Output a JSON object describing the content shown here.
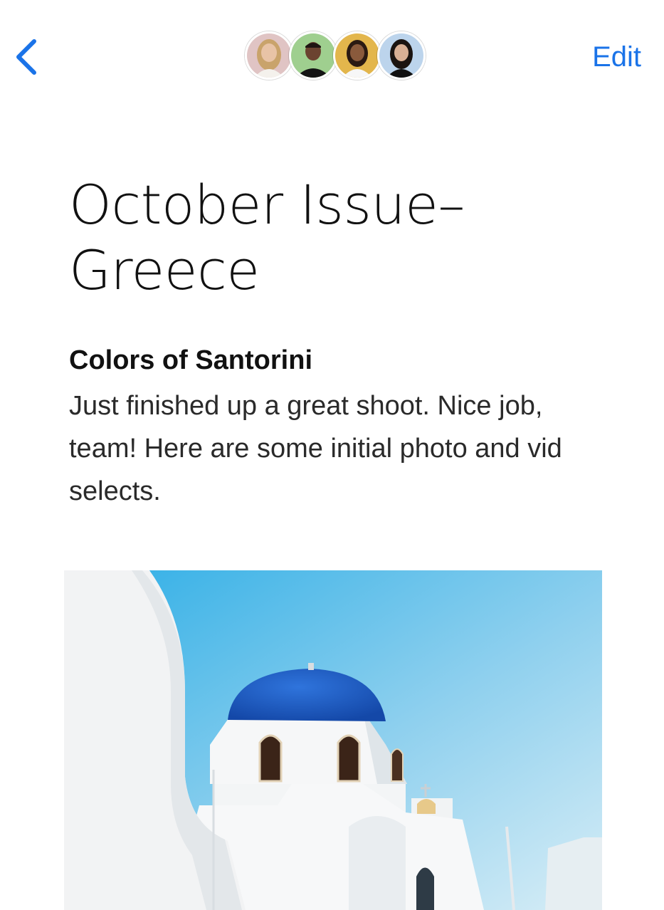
{
  "nav": {
    "edit_label": "Edit"
  },
  "collaborators": [
    {
      "avatar_bg": "#e0c4c4",
      "skin": "#e8c3a6",
      "hair": "#c9a36b"
    },
    {
      "avatar_bg": "#9fcf8f",
      "skin": "#6b4330",
      "hair": "#1f1512"
    },
    {
      "avatar_bg": "#e3b64c",
      "skin": "#8a5a3c",
      "hair": "#2b1a12"
    },
    {
      "avatar_bg": "#bcd4ec",
      "skin": "#d9b095",
      "hair": "#1b1411"
    }
  ],
  "document": {
    "title_line1": "October Issue–",
    "title_line2": "Greece",
    "section_heading": "Colors of Santorini",
    "section_body": "Just finished up a great shoot. Nice job, team! Here are some initial photo and vid selects."
  },
  "colors": {
    "accent": "#1a73e8",
    "dome_blue": "#1f5fc8",
    "sky_top": "#3cb2e8",
    "sky_bottom": "#cfe9f5"
  },
  "icons": {
    "back": "chevron-left"
  }
}
